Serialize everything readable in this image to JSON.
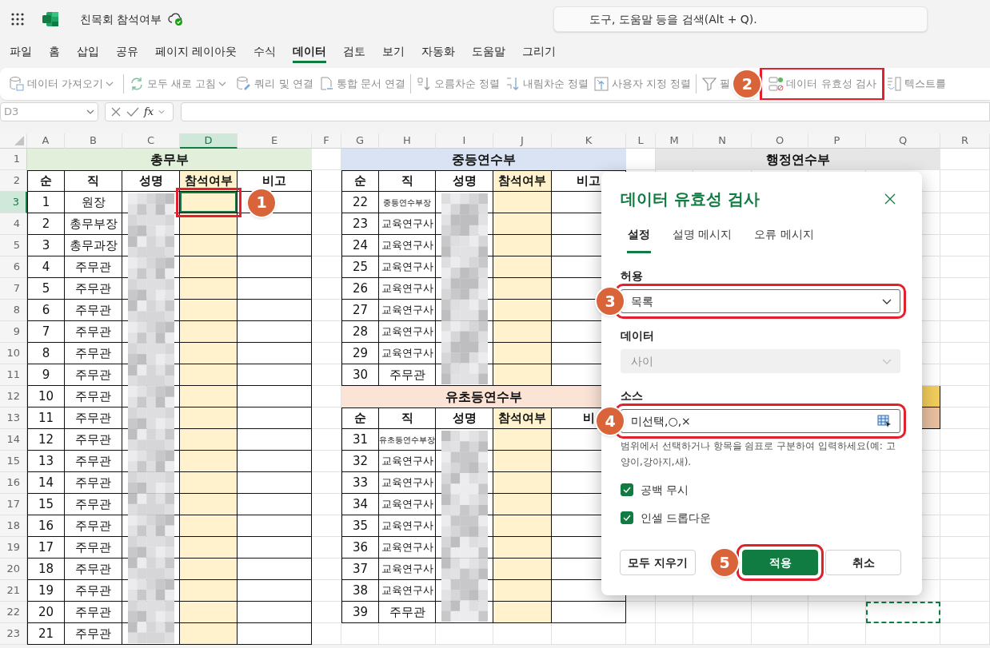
{
  "app": {
    "title": "친목회 참석여부",
    "search": {
      "placeholder": "도구, 도움말 등을 검색(Alt + Q)."
    }
  },
  "menu_tabs": [
    {
      "label": "파일",
      "selected": false
    },
    {
      "label": "홈",
      "selected": false
    },
    {
      "label": "삽입",
      "selected": false
    },
    {
      "label": "공유",
      "selected": false
    },
    {
      "label": "페이지 레이아웃",
      "selected": false
    },
    {
      "label": "수식",
      "selected": false
    },
    {
      "label": "데이터",
      "selected": true
    },
    {
      "label": "검토",
      "selected": false
    },
    {
      "label": "보기",
      "selected": false
    },
    {
      "label": "자동화",
      "selected": false
    },
    {
      "label": "도움말",
      "selected": false
    },
    {
      "label": "그리기",
      "selected": false
    }
  ],
  "ribbon": {
    "groups": [
      {
        "items": [
          {
            "label": "데이터 가져오기",
            "has_menu": true
          }
        ]
      },
      {
        "items": [
          {
            "label": "모두 새로 고침",
            "has_menu": true
          },
          {
            "label": "쿼리 및 연결",
            "has_menu": false
          },
          {
            "label": "통합 문서 연결",
            "has_menu": false
          }
        ]
      },
      {
        "items": [
          {
            "label": "오름차순 정렬",
            "has_menu": false
          },
          {
            "label": "내림차순 정렬",
            "has_menu": false
          },
          {
            "label": "사용자 지정 정렬",
            "has_menu": false
          }
        ]
      },
      {
        "items": [
          {
            "label": "필",
            "has_menu": false
          },
          {
            "label": "데이터 유효성 검사",
            "has_menu": false,
            "callout": "2"
          },
          {
            "label": "텍스트를",
            "has_menu": false
          }
        ]
      }
    ]
  },
  "formula_bar": {
    "name_box": "D3",
    "function_label": "fx"
  },
  "sheet": {
    "columns": [
      {
        "label": "A",
        "selected": false
      },
      {
        "label": "B",
        "selected": false
      },
      {
        "label": "C",
        "selected": false
      },
      {
        "label": "D",
        "selected": true
      },
      {
        "label": "E",
        "selected": false
      },
      {
        "label": "F",
        "selected": false
      },
      {
        "label": "G",
        "selected": false
      },
      {
        "label": "H",
        "selected": false
      },
      {
        "label": "I",
        "selected": false
      },
      {
        "label": "J",
        "selected": false
      },
      {
        "label": "K",
        "selected": false
      },
      {
        "label": "L",
        "selected": false
      },
      {
        "label": "M",
        "selected": false
      },
      {
        "label": "N",
        "selected": false
      },
      {
        "label": "O",
        "selected": false
      },
      {
        "label": "P",
        "selected": false
      },
      {
        "label": "Q",
        "selected": false
      },
      {
        "label": "R",
        "selected": false
      }
    ],
    "rows": [
      {
        "label": "1",
        "selected": false
      },
      {
        "label": "2",
        "selected": false
      },
      {
        "label": "3",
        "selected": true
      },
      {
        "label": "4",
        "selected": false
      },
      {
        "label": "5",
        "selected": false
      },
      {
        "label": "6",
        "selected": false
      },
      {
        "label": "7",
        "selected": false
      },
      {
        "label": "8",
        "selected": false
      },
      {
        "label": "9",
        "selected": false
      },
      {
        "label": "10",
        "selected": false
      },
      {
        "label": "11",
        "selected": false
      },
      {
        "label": "12",
        "selected": false
      },
      {
        "label": "13",
        "selected": false
      },
      {
        "label": "14",
        "selected": false
      },
      {
        "label": "15",
        "selected": false
      },
      {
        "label": "16",
        "selected": false
      },
      {
        "label": "17",
        "selected": false
      },
      {
        "label": "18",
        "selected": false
      },
      {
        "label": "19",
        "selected": false
      },
      {
        "label": "20",
        "selected": false
      },
      {
        "label": "21",
        "selected": false
      },
      {
        "label": "22",
        "selected": false
      },
      {
        "label": "23",
        "selected": false
      }
    ],
    "active_cell_callout": "1",
    "copy_marquee": true,
    "tables": [
      {
        "title": "총무부",
        "color": "#e2efda",
        "columns": [
          {
            "label": "순",
            "highlighted": false,
            "redacted": false
          },
          {
            "label": "직",
            "highlighted": false,
            "redacted": false
          },
          {
            "label": "성명",
            "highlighted": false,
            "redacted": true
          },
          {
            "label": "참석여부",
            "highlighted": true,
            "redacted": false
          },
          {
            "label": "비고",
            "highlighted": false,
            "redacted": false
          }
        ],
        "rows": [
          [
            "1",
            "원장"
          ],
          [
            "2",
            "총무부장"
          ],
          [
            "3",
            "총무과장"
          ],
          [
            "4",
            "주무관"
          ],
          [
            "5",
            "주무관"
          ],
          [
            "6",
            "주무관"
          ],
          [
            "7",
            "주무관"
          ],
          [
            "8",
            "주무관"
          ],
          [
            "9",
            "주무관"
          ],
          [
            "10",
            "주무관"
          ],
          [
            "11",
            "주무관"
          ],
          [
            "12",
            "주무관"
          ],
          [
            "13",
            "주무관"
          ],
          [
            "14",
            "주무관"
          ],
          [
            "15",
            "주무관"
          ],
          [
            "16",
            "주무관"
          ],
          [
            "17",
            "주무관"
          ],
          [
            "18",
            "주무관"
          ],
          [
            "19",
            "주무관"
          ],
          [
            "20",
            "주무관"
          ],
          [
            "21",
            "주무관"
          ]
        ]
      },
      {
        "title": "중등연수부",
        "color": "#dae3f3",
        "columns": [
          {
            "label": "순",
            "highlighted": false,
            "redacted": false
          },
          {
            "label": "직",
            "highlighted": false,
            "redacted": false
          },
          {
            "label": "성명",
            "highlighted": false,
            "redacted": true
          },
          {
            "label": "참석여부",
            "highlighted": true,
            "redacted": false
          },
          {
            "label": "비고",
            "highlighted": false,
            "redacted": false
          }
        ],
        "rows": [
          [
            "22",
            "중등연수부장"
          ],
          [
            "23",
            "교육연구사"
          ],
          [
            "24",
            "교육연구사"
          ],
          [
            "25",
            "교육연구사"
          ],
          [
            "26",
            "교육연구사"
          ],
          [
            "27",
            "교육연구사"
          ],
          [
            "28",
            "교육연구사"
          ],
          [
            "29",
            "교육연구사"
          ],
          [
            "30",
            "주무관"
          ]
        ]
      },
      {
        "title": "유초등연수부",
        "color": "#fbe3d6",
        "columns": [
          {
            "label": "순",
            "highlighted": false,
            "redacted": false
          },
          {
            "label": "직",
            "highlighted": false,
            "redacted": false
          },
          {
            "label": "성명",
            "highlighted": false,
            "redacted": true
          },
          {
            "label": "참석여부",
            "highlighted": true,
            "redacted": false
          },
          {
            "label": "비",
            "highlighted": false,
            "redacted": false
          }
        ],
        "rows": [
          [
            "31",
            "유초등연수부장"
          ],
          [
            "32",
            "교육연구사"
          ],
          [
            "33",
            "교육연구사"
          ],
          [
            "34",
            "교육연구사"
          ],
          [
            "35",
            "교육연구사"
          ],
          [
            "36",
            "교육연구사"
          ],
          [
            "37",
            "교육연구사"
          ],
          [
            "38",
            "교육연구사"
          ],
          [
            "39",
            "주무관"
          ]
        ]
      },
      {
        "title": "행정연수부",
        "color": "#e7e6e6"
      }
    ],
    "fills": [
      {
        "color": "#f2cd5c"
      },
      {
        "color": "#e8c0a0"
      }
    ]
  },
  "dialog": {
    "title": "데이터 유효성 검사",
    "tabs": [
      {
        "label": "설정",
        "selected": true
      },
      {
        "label": "설명 메시지",
        "selected": false
      },
      {
        "label": "오류 메시지",
        "selected": false
      }
    ],
    "fields": [
      {
        "label": "허용",
        "kind": "select",
        "value": "목록",
        "disabled": false,
        "callout": "3"
      },
      {
        "label": "데이터",
        "kind": "select",
        "value": "사이",
        "disabled": true
      },
      {
        "label": "소스",
        "kind": "range",
        "value": "미선택,○,×",
        "disabled": false,
        "callout": "4",
        "help": "범위에서 선택하거나 항목을 쉼표로 구분하여 입력하세요(예: 고양이,강아지,새)."
      }
    ],
    "checkboxes": [
      {
        "label": "공백 무시",
        "checked": true
      },
      {
        "label": "인셀 드롭다운",
        "checked": true
      }
    ],
    "buttons": [
      {
        "label": "모두 지우기",
        "primary": false
      },
      {
        "label": "적용",
        "primary": true,
        "callout": "5"
      },
      {
        "label": "취소",
        "primary": false
      }
    ]
  }
}
